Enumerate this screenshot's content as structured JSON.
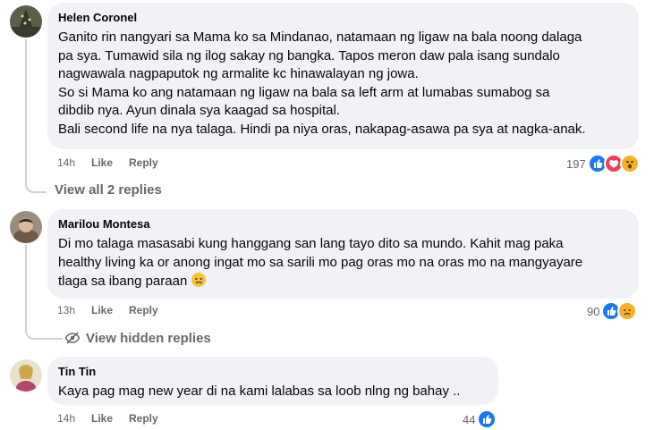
{
  "comments": [
    {
      "author": "Helen Coronel",
      "lines": [
        "Ganito rin nangyari sa Mama ko sa Mindanao, natamaan ng ligaw na bala noong dalaga",
        "pa sya. Tumawid sila ng ilog sakay ng bangka. Tapos meron daw pala isang sundalo",
        "nagwawala nagpaputok ng armalite kc hinawalayan ng jowa.",
        "So si Mama ko ang natamaan ng ligaw na bala sa left arm at lumabas sumabog sa",
        "dibdib nya. Ayun dinala sya kaagad sa hospital.",
        "Bali second life na nya talaga. Hindi pa niya oras, nakapag-asawa pa sya at nagka-anak."
      ],
      "time": "14h",
      "like_label": "Like",
      "reply_label": "Reply",
      "reaction_count": "197",
      "reactions": [
        "like-icon",
        "love-icon",
        "wow-icon"
      ]
    },
    {
      "author": "Marilou Montesa",
      "lines": [
        "Di mo talaga masasabi kung hanggang san lang tayo dito sa mundo. Kahit mag paka",
        "healthy living ka or anong ingat mo sa sarili mo pag oras mo na oras mo na mangyayare",
        "tlaga sa ibang paraan"
      ],
      "time": "13h",
      "like_label": "Like",
      "reply_label": "Reply",
      "reaction_count": "90",
      "reactions": [
        "like-icon",
        "sad-icon"
      ]
    },
    {
      "author": "Tin Tin",
      "lines": [
        "Kaya pag mag new year di na kami lalabas sa loob nlng ng bahay .."
      ],
      "time": "14h",
      "like_label": "Like",
      "reply_label": "Reply",
      "reaction_count": "44",
      "reactions": [
        "like-icon"
      ]
    }
  ],
  "view_replies_label": "View all 2 replies",
  "view_hidden_label": "View hidden replies",
  "colors": {
    "bubble": "#f0f2f5",
    "meta_text": "#65676b",
    "like_blue": "#1877f2",
    "love_red": "#f33e58",
    "wow_yellow": "#f7b125"
  }
}
